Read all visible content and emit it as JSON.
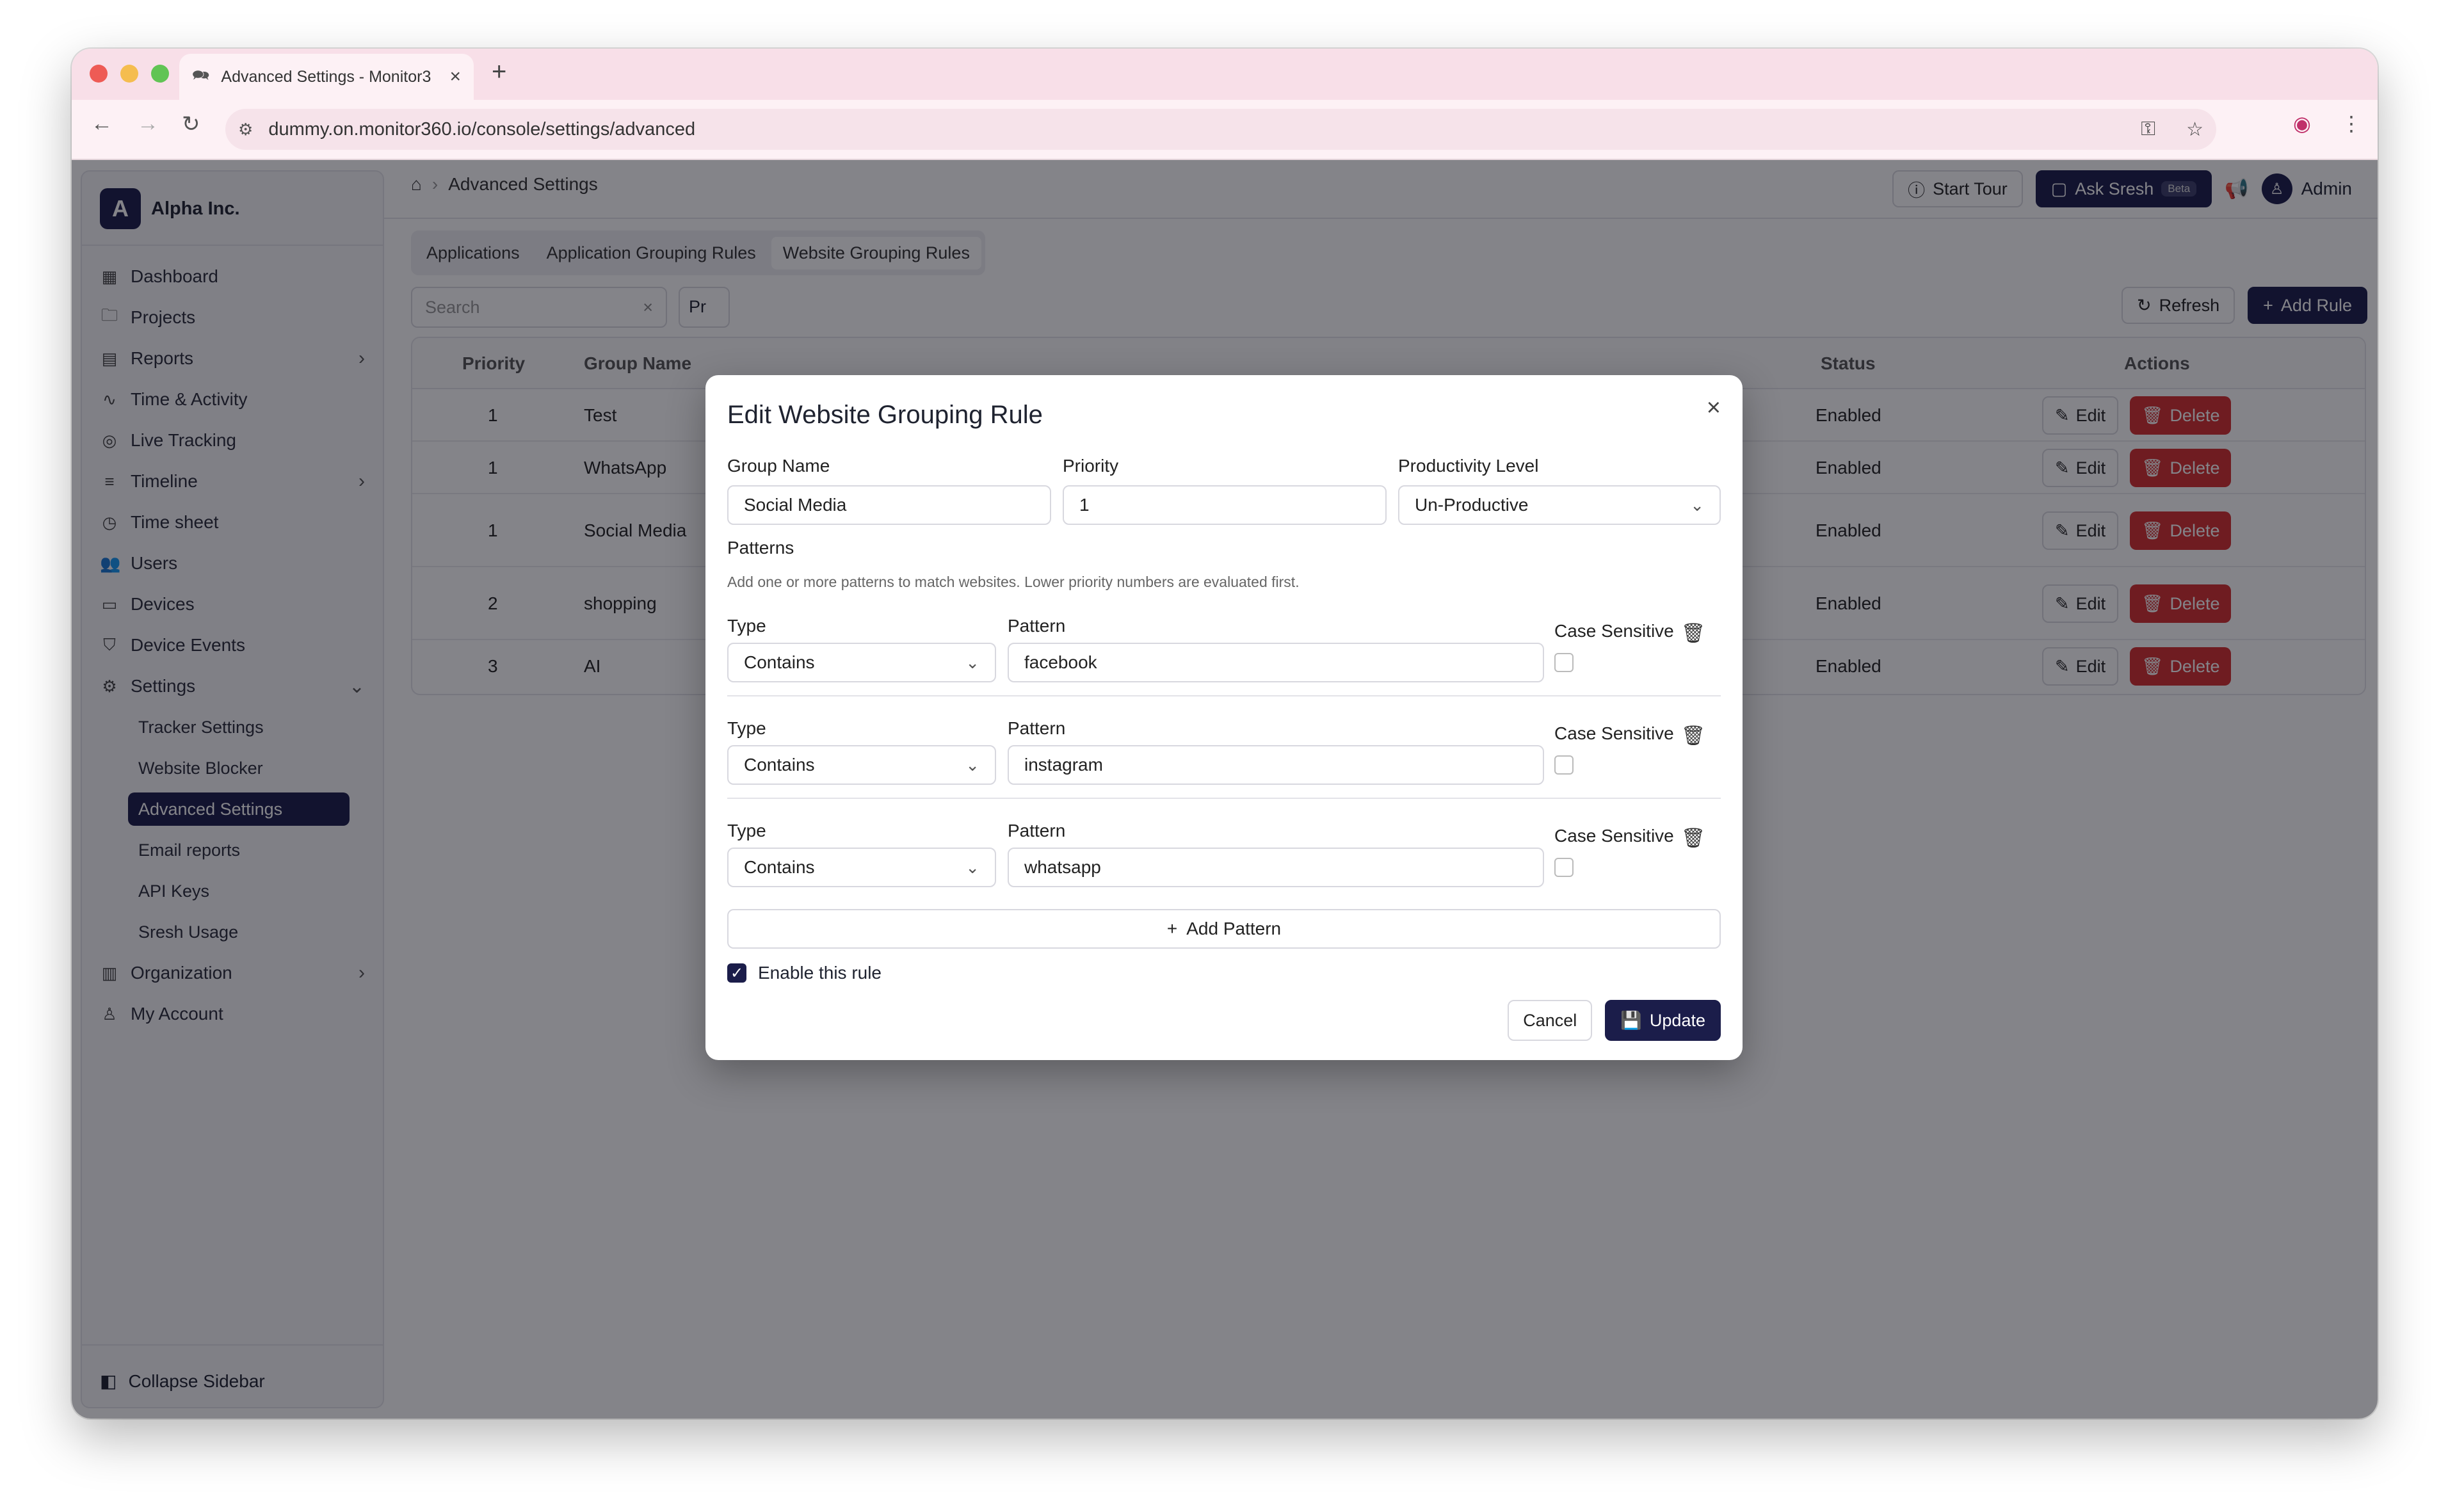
{
  "browser": {
    "tab_title": "Advanced Settings - Monitor3",
    "url": "dummy.on.monitor360.io/console/settings/advanced",
    "traffic_colors": [
      "#ee5b55",
      "#f5bd4f",
      "#61c454"
    ]
  },
  "org": {
    "initial": "A",
    "name": "Alpha Inc."
  },
  "sidebar": {
    "items": [
      {
        "label": "Dashboard",
        "icon": "dashboard-icon"
      },
      {
        "label": "Projects",
        "icon": "folder-icon"
      },
      {
        "label": "Reports",
        "icon": "file-icon"
      },
      {
        "label": "Time & Activity",
        "icon": "activity-icon"
      },
      {
        "label": "Live Tracking",
        "icon": "radio-icon"
      },
      {
        "label": "Timeline",
        "icon": "timeline-icon"
      },
      {
        "label": "Time sheet",
        "icon": "timer-icon"
      },
      {
        "label": "Users",
        "icon": "users-icon"
      },
      {
        "label": "Devices",
        "icon": "monitor-icon"
      },
      {
        "label": "Device Events",
        "icon": "shield-icon"
      },
      {
        "label": "Settings",
        "icon": "gear-icon"
      }
    ],
    "settings_sub": [
      "Tracker Settings",
      "Website Blocker",
      "Advanced Settings",
      "Email reports",
      "API Keys",
      "Sresh Usage"
    ],
    "bottom_items": [
      {
        "label": "Organization",
        "icon": "building-icon"
      },
      {
        "label": "My Account",
        "icon": "user-icon"
      }
    ],
    "collapse_label": "Collapse Sidebar"
  },
  "header": {
    "breadcrumb": "Advanced Settings",
    "start_tour": "Start Tour",
    "ask": "Ask Sresh",
    "ask_badge": "Beta",
    "user": "Admin"
  },
  "tabs": [
    "Applications",
    "Application Grouping Rules",
    "Website Grouping Rules"
  ],
  "toolbar": {
    "search_placeholder": "Search",
    "pr_label": "Pr",
    "refresh": "Refresh",
    "add_rule": "Add Rule"
  },
  "table": {
    "headers": {
      "priority": "Priority",
      "group": "Group Name",
      "status": "Status",
      "actions": "Actions"
    },
    "rows": [
      {
        "priority": "1",
        "group": "Test",
        "status": "Enabled"
      },
      {
        "priority": "1",
        "group": "WhatsApp",
        "status": "Enabled"
      },
      {
        "priority": "1",
        "group": "Social Media",
        "status": "Enabled"
      },
      {
        "priority": "2",
        "group": "shopping",
        "status": "Enabled"
      },
      {
        "priority": "3",
        "group": "AI",
        "status": "Enabled"
      }
    ],
    "edit_label": "Edit",
    "delete_label": "Delete"
  },
  "modal": {
    "title": "Edit Website Grouping Rule",
    "group_name_label": "Group Name",
    "group_name": "Social Media",
    "priority_label": "Priority",
    "priority": "1",
    "productivity_label": "Productivity Level",
    "productivity": "Un-Productive",
    "patterns_label": "Patterns",
    "patterns_hint": "Add one or more patterns to match websites. Lower priority numbers are evaluated first.",
    "type_label": "Type",
    "pattern_label": "Pattern",
    "case_label": "Case Sensitive",
    "patterns": [
      {
        "type": "Contains",
        "pattern": "facebook"
      },
      {
        "type": "Contains",
        "pattern": "instagram"
      },
      {
        "type": "Contains",
        "pattern": "whatsapp"
      }
    ],
    "add_pattern": "Add Pattern",
    "enable_label": "Enable this rule",
    "cancel": "Cancel",
    "update": "Update"
  }
}
